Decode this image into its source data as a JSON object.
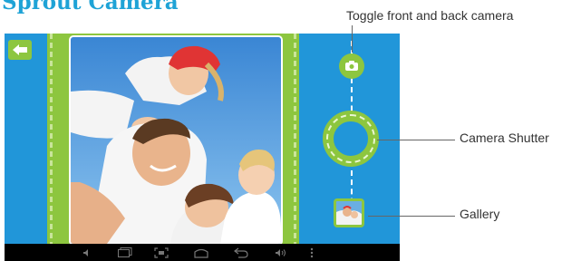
{
  "title": "Sprout Camera",
  "callouts": {
    "toggle": "Toggle front and back camera",
    "shutter": "Camera Shutter",
    "gallery": "Gallery"
  },
  "icons": {
    "back": "back-arrow-icon",
    "toggle": "camera-switch-icon",
    "shutter": "shutter-ring",
    "gallery": "gallery-thumbnail",
    "nav": [
      "volume-down-icon",
      "recent-apps-icon",
      "screenshot-icon",
      "home-icon",
      "back-icon",
      "volume-up-icon",
      "menu-icon"
    ]
  },
  "colors": {
    "title": "#1fa3d6",
    "background": "#2196d9",
    "accent": "#8dc63f",
    "navbar": "#000000"
  }
}
